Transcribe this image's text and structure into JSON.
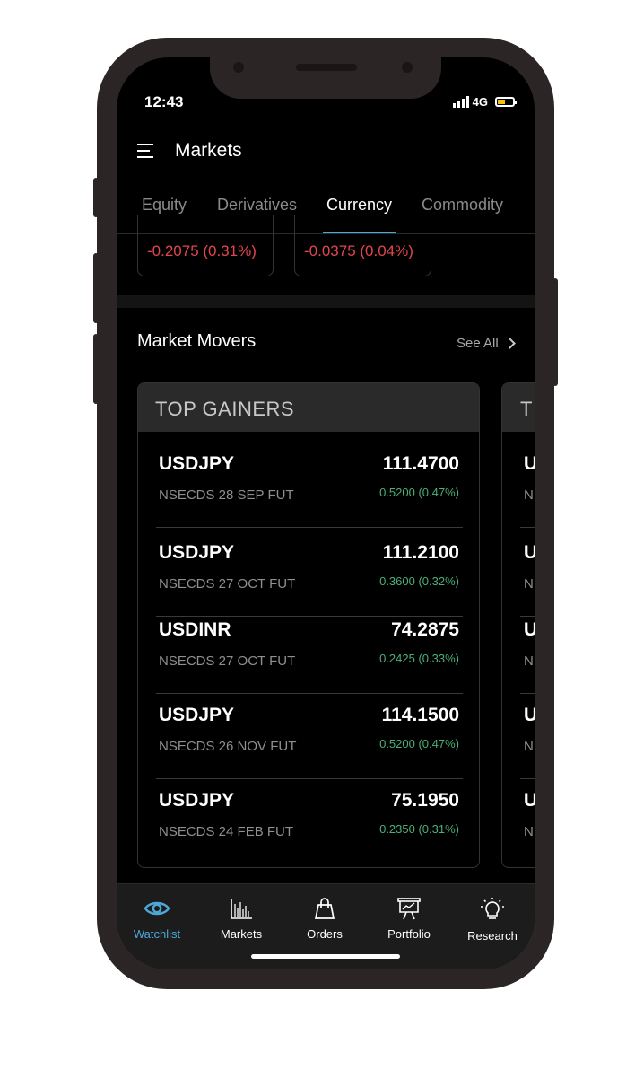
{
  "status_bar": {
    "time": "12:43",
    "network": "4G"
  },
  "header": {
    "title": "Markets"
  },
  "tabs": [
    {
      "label": "Equity",
      "active": false
    },
    {
      "label": "Derivatives",
      "active": false
    },
    {
      "label": "Currency",
      "active": true
    },
    {
      "label": "Commodity",
      "active": false
    }
  ],
  "index_cards": [
    {
      "change": "-0.2075 (0.31%)"
    },
    {
      "change": "-0.0375 (0.04%)"
    }
  ],
  "market_movers": {
    "title": "Market Movers",
    "see_all": "See All",
    "card_title": "TOP GAINERS",
    "next_card_title_partial": "T",
    "rows": [
      {
        "symbol": "USDJPY",
        "expiry": "NSECDS 28 SEP FUT",
        "price": "111.4700",
        "change": "0.5200 (0.47%)"
      },
      {
        "symbol": "USDJPY",
        "expiry": "NSECDS 27 OCT FUT",
        "price": "111.2100",
        "change": "0.3600 (0.32%)"
      },
      {
        "symbol": "USDINR",
        "expiry": "NSECDS 27 OCT FUT",
        "price": "74.2875",
        "change": "0.2425 (0.33%)"
      },
      {
        "symbol": "USDJPY",
        "expiry": "NSECDS 26 NOV FUT",
        "price": "114.1500",
        "change": "0.5200 (0.47%)"
      },
      {
        "symbol": "USDJPY",
        "expiry": "NSECDS 24 FEB FUT",
        "price": "75.1950",
        "change": "0.2350 (0.31%)"
      }
    ],
    "next_card_rows_partial": [
      {
        "s": "U",
        "n": "N"
      },
      {
        "s": "U",
        "n": "N"
      },
      {
        "s": "U",
        "n": "N"
      },
      {
        "s": "U",
        "n": "N"
      },
      {
        "s": "U",
        "n": "N"
      }
    ]
  },
  "bottom_nav": [
    {
      "label": "Watchlist",
      "icon": "eye-icon",
      "active": true
    },
    {
      "label": "Markets",
      "icon": "bar-chart-icon",
      "active": false
    },
    {
      "label": "Orders",
      "icon": "shopping-bag-icon",
      "active": false
    },
    {
      "label": "Portfolio",
      "icon": "presentation-board-icon",
      "active": false
    },
    {
      "label": "Research",
      "icon": "lightbulb-icon",
      "active": false
    }
  ],
  "colors": {
    "accent": "#4da8d8",
    "negative": "#e0474c",
    "positive": "#4caf78",
    "background": "#000000"
  }
}
